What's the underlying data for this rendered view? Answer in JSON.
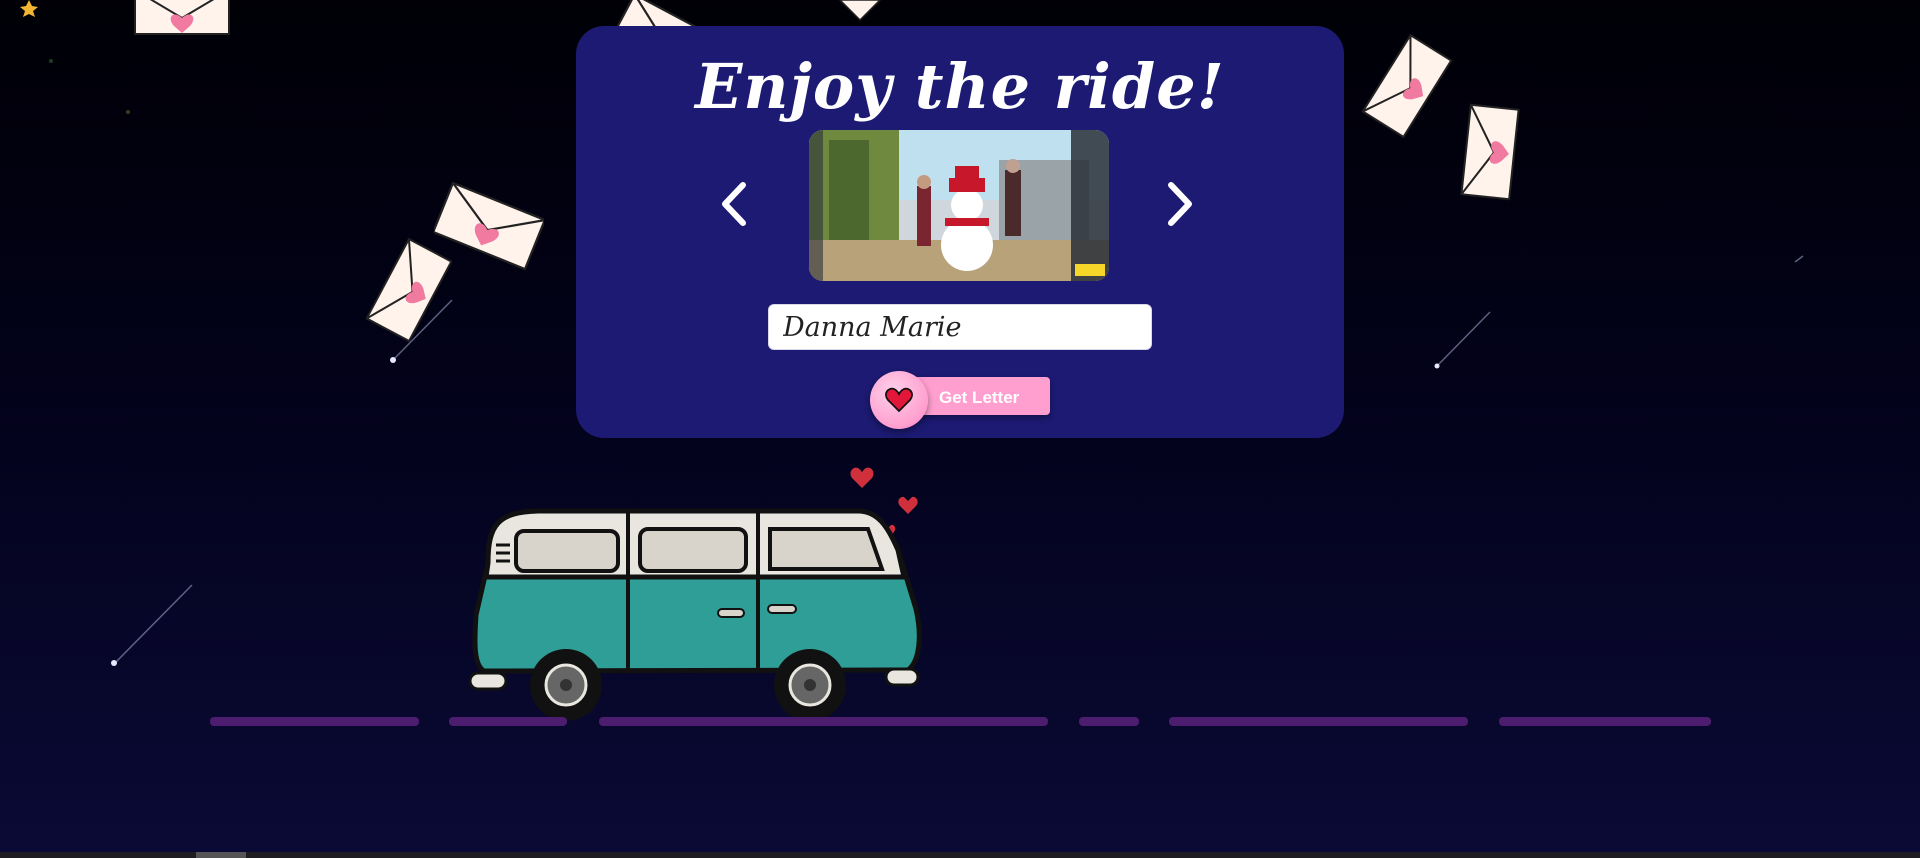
{
  "page": {
    "title": "Enjoy the ride!",
    "name_value": "Danna Marie",
    "get_letter_label": "Get Letter"
  },
  "carousel": {
    "prev_icon": "chevron-left-icon",
    "next_icon": "chevron-right-icon"
  },
  "colors": {
    "card": "#1c1a72",
    "button_pink": "#ff9fcf",
    "road": "#4c1d6e",
    "van_teal": "#2e9e96"
  }
}
